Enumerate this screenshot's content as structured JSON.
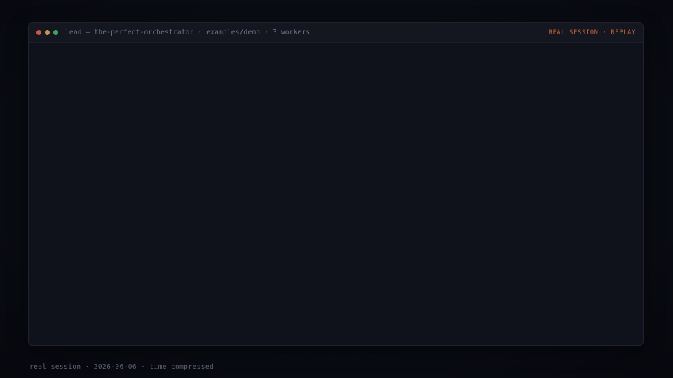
{
  "window": {
    "title": "lead — the-perfect-orchestrator · examples/demo · 3 workers",
    "session_label": "REAL SESSION · REPLAY",
    "controls": [
      {
        "icon": "close-dot-icon",
        "color": "#c95a4a"
      },
      {
        "icon": "minimize-dot-icon",
        "color": "#c98f5a"
      },
      {
        "icon": "maximize-dot-icon",
        "color": "#3fa55a"
      }
    ]
  },
  "footer": {
    "caption": "real session · 2026-06-06 · time compressed"
  },
  "colors": {
    "accent": "#c8643f",
    "background": "#090b12",
    "terminal": "#0f121a"
  }
}
